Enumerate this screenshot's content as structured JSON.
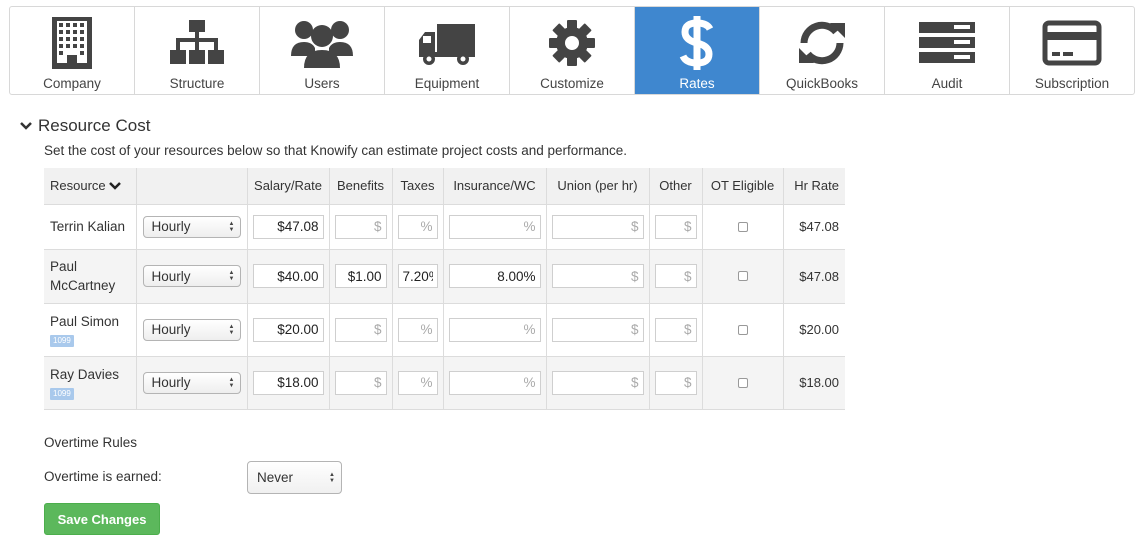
{
  "nav": {
    "items": [
      {
        "label": "Company",
        "icon": "building-icon"
      },
      {
        "label": "Structure",
        "icon": "org-chart-icon"
      },
      {
        "label": "Users",
        "icon": "users-icon"
      },
      {
        "label": "Equipment",
        "icon": "truck-icon"
      },
      {
        "label": "Customize",
        "icon": "gear-icon"
      },
      {
        "label": "Rates",
        "icon": "dollar-icon",
        "active": true
      },
      {
        "label": "QuickBooks",
        "icon": "sync-icon"
      },
      {
        "label": "Audit",
        "icon": "server-icon"
      },
      {
        "label": "Subscription",
        "icon": "credit-card-icon"
      }
    ],
    "active_color": "#3f87cf"
  },
  "section": {
    "title": "Resource Cost",
    "description": "Set the cost of your resources below so that Knowify can estimate project costs and performance."
  },
  "table": {
    "headers": {
      "resource": "Resource",
      "type": "",
      "salary": "Salary/Rate",
      "benefits": "Benefits",
      "taxes": "Taxes",
      "insurance": "Insurance/WC",
      "union": "Union (per hr)",
      "other": "Other",
      "ot": "OT Eligible",
      "hr_rate": "Hr Rate"
    },
    "placeholders": {
      "benefits": "$",
      "taxes": "%",
      "insurance": "%",
      "union": "$",
      "other": "$"
    },
    "rows": [
      {
        "name": "Terrin Kalian",
        "badge": "",
        "type": "Hourly",
        "salary": "$47.08",
        "benefits": "",
        "taxes": "",
        "insurance": "",
        "union": "",
        "other": "",
        "ot": false,
        "hr_rate": "$47.08"
      },
      {
        "name": "Paul McCartney",
        "badge": "",
        "type": "Hourly",
        "salary": "$40.00",
        "benefits": "$1.00",
        "taxes": "7.20%",
        "insurance": "8.00%",
        "union": "",
        "other": "",
        "ot": false,
        "hr_rate": "$47.08"
      },
      {
        "name": "Paul Simon",
        "badge": "1099",
        "type": "Hourly",
        "salary": "$20.00",
        "benefits": "",
        "taxes": "",
        "insurance": "",
        "union": "",
        "other": "",
        "ot": false,
        "hr_rate": "$20.00"
      },
      {
        "name": "Ray Davies",
        "badge": "1099",
        "type": "Hourly",
        "salary": "$18.00",
        "benefits": "",
        "taxes": "",
        "insurance": "",
        "union": "",
        "other": "",
        "ot": false,
        "hr_rate": "$18.00"
      }
    ]
  },
  "overtime": {
    "title": "Overtime Rules",
    "label": "Overtime is earned:",
    "value": "Never"
  },
  "save_label": "Save Changes",
  "colors": {
    "save_button": "#5cb85c",
    "badge": "#a9c9ec"
  }
}
